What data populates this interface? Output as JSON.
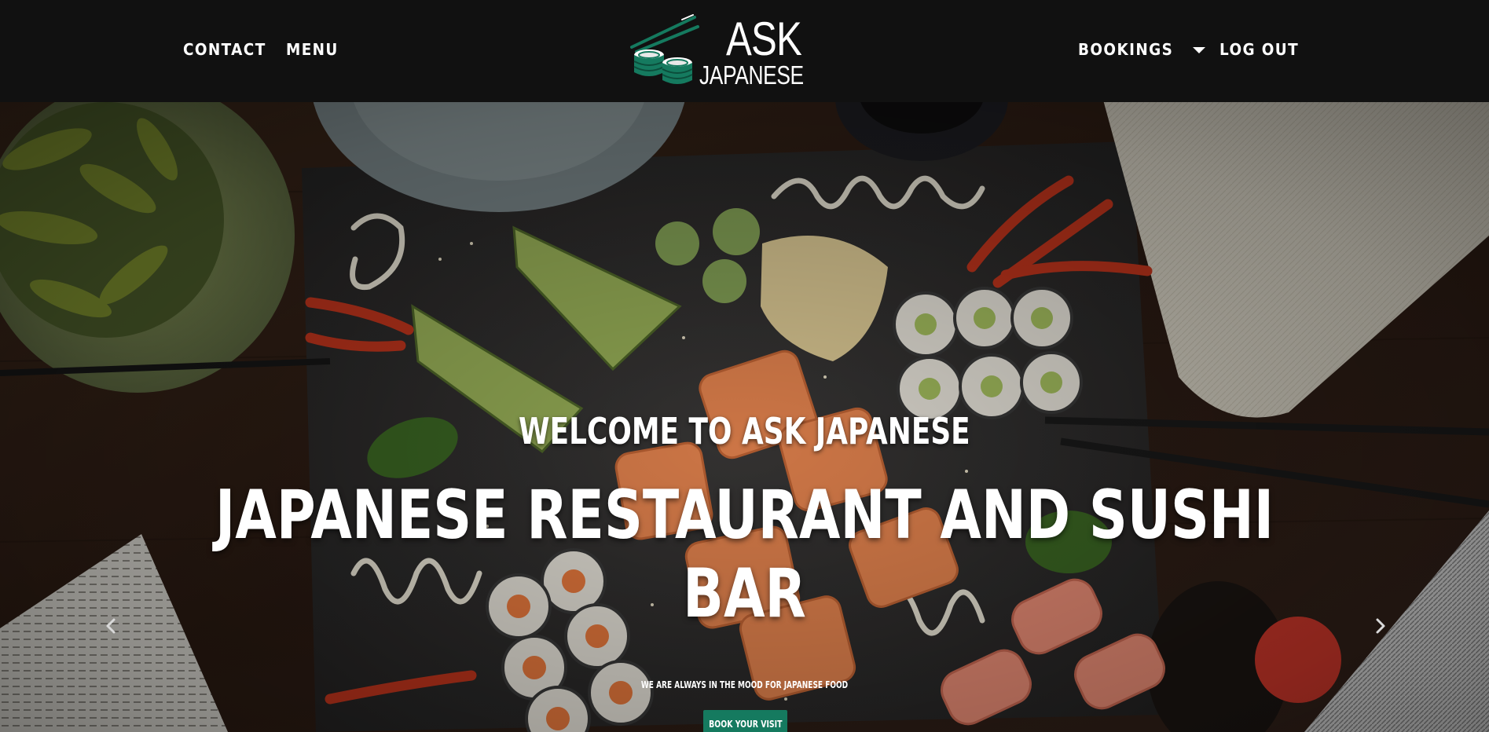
{
  "header": {
    "nav_left": [
      {
        "label": "CONTACT"
      },
      {
        "label": "MENU"
      }
    ],
    "logo": {
      "line1": "ASK",
      "line2": "JAPANESE",
      "icon": "sushi-chopsticks-logo-icon"
    },
    "nav_right": {
      "dropdown_label": "BOOKINGS",
      "logout_label": "LOG OUT"
    }
  },
  "hero": {
    "welcome": "WELCOME TO ASK JAPANESE",
    "title": "JAPANESE RESTAURANT AND SUSHI BAR",
    "tagline": "WE ARE ALWAYS IN THE MOOD FOR JAPANESE FOOD",
    "cta_label": "BOOK YOUR VISIT",
    "prev_icon": "chevron-left-icon",
    "next_icon": "chevron-right-icon"
  },
  "colors": {
    "nav_bg": "#111111",
    "accent": "#157a5f",
    "text": "#ffffff"
  }
}
